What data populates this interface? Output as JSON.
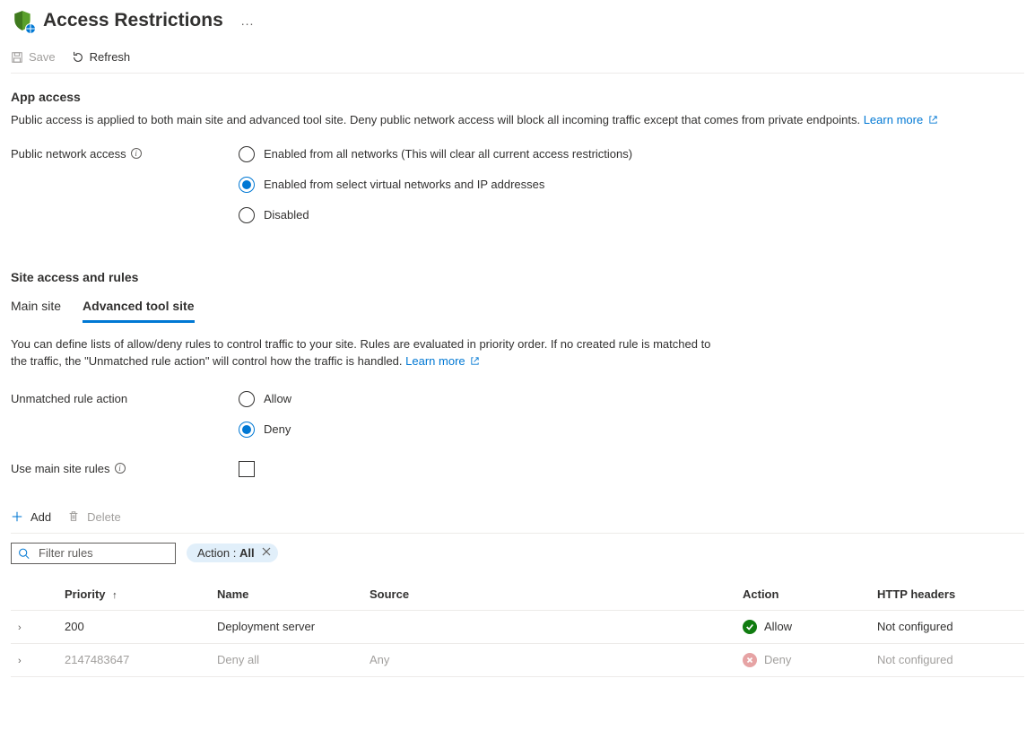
{
  "header": {
    "title": "Access Restrictions",
    "more_label": "..."
  },
  "toolbar": {
    "save_label": "Save",
    "refresh_label": "Refresh"
  },
  "app_access": {
    "heading": "App access",
    "description": "Public access is applied to both main site and advanced tool site. Deny public network access will block all incoming traffic except that comes from private endpoints.",
    "learn_more": "Learn more",
    "public_label": "Public network access",
    "options": {
      "all": "Enabled from all networks (This will clear all current access restrictions)",
      "select": "Enabled from select virtual networks and IP addresses",
      "disabled": "Disabled"
    }
  },
  "site_access": {
    "heading": "Site access and rules",
    "tabs": {
      "main": "Main site",
      "advanced": "Advanced tool site"
    },
    "description": "You can define lists of allow/deny rules to control traffic to your site. Rules are evaluated in priority order. If no created rule is matched to the traffic, the \"Unmatched rule action\" will control how the traffic is handled.",
    "learn_more": "Learn more",
    "unmatched_label": "Unmatched rule action",
    "unmatched_options": {
      "allow": "Allow",
      "deny": "Deny"
    },
    "use_main_label": "Use main site rules"
  },
  "rules_toolbar": {
    "add": "Add",
    "delete": "Delete"
  },
  "filter": {
    "placeholder": "Filter rules",
    "pill_key": "Action : ",
    "pill_value": "All"
  },
  "table": {
    "headers": {
      "priority": "Priority",
      "name": "Name",
      "source": "Source",
      "action": "Action",
      "http": "HTTP headers"
    },
    "rows": [
      {
        "priority": "200",
        "name": "Deployment server",
        "source": "",
        "action": "allow",
        "action_label": "Allow",
        "http": "Not configured",
        "muted": false
      },
      {
        "priority": "2147483647",
        "name": "Deny all",
        "source": "Any",
        "action": "deny",
        "action_label": "Deny",
        "http": "Not configured",
        "muted": true
      }
    ]
  }
}
